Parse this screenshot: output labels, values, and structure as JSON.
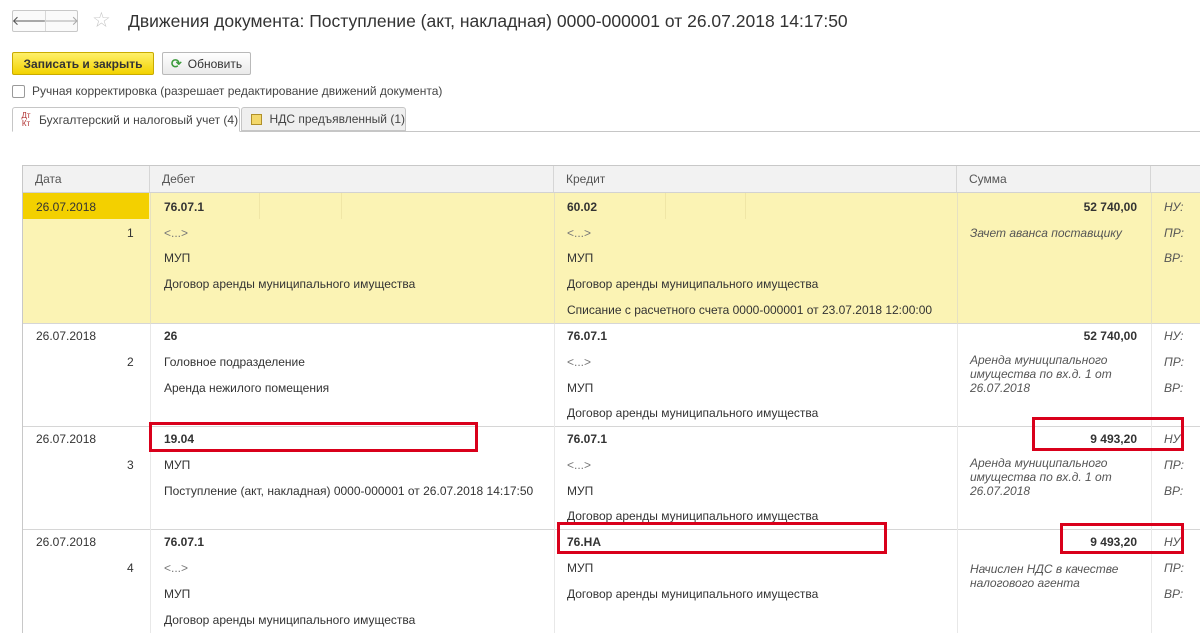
{
  "window": {
    "title": "Движения документа: Поступление (акт, накладная) 0000-000001 от 26.07.2018 14:17:50",
    "back_icon": "arrow-left-icon",
    "forward_icon": "arrow-right-icon",
    "favorite_icon": "star-icon"
  },
  "toolbar": {
    "save_close_label": "Записать и закрыть",
    "refresh_label": "Обновить",
    "refresh_icon": "refresh-icon"
  },
  "manual_correction": {
    "label": "Ручная корректировка (разрешает редактирование движений документа)",
    "checked": false
  },
  "tabs": [
    {
      "label": "Бухгалтерский и налоговый учет (4)",
      "icon": "dt-kt-icon",
      "icon_text": "Дт\nКт",
      "active": true
    },
    {
      "label": "НДС предъявленный (1)",
      "icon": "register-icon",
      "active": false
    }
  ],
  "grid": {
    "columns": [
      "Дата",
      "Дебет",
      "Кредит",
      "Сумма"
    ],
    "records": [
      {
        "date": "26.07.2018",
        "num": "1",
        "debit": [
          "76.07.1",
          "<...>",
          "МУП",
          "Договор аренды муниципального имущества"
        ],
        "credit": [
          "60.02",
          "<...>",
          "МУП",
          "Договор аренды муниципального имущества",
          "Списание с расчетного счета 0000-000001 от 23.07.2018 12:00:00"
        ],
        "sum": "52 740,00",
        "note": "Зачет аванса поставщику",
        "flags": [
          "НУ:",
          "ПР:",
          "ВР:"
        ],
        "selected": true
      },
      {
        "date": "26.07.2018",
        "num": "2",
        "debit": [
          "26",
          "Головное подразделение",
          "Аренда нежилого помещения"
        ],
        "credit": [
          "76.07.1",
          "<...>",
          "МУП",
          "Договор аренды муниципального имущества"
        ],
        "sum": "52 740,00",
        "note": "Аренда муниципального имущества по вх.д. 1 от 26.07.2018",
        "flags": [
          "НУ:",
          "ПР:",
          "ВР:"
        ],
        "selected": false
      },
      {
        "date": "26.07.2018",
        "num": "3",
        "debit": [
          "19.04",
          "МУП",
          "Поступление (акт, накладная) 0000-000001 от 26.07.2018 14:17:50"
        ],
        "credit": [
          "76.07.1",
          "<...>",
          "МУП",
          "Договор аренды муниципального имущества"
        ],
        "sum": "9 493,20",
        "note": "Аренда муниципального имущества по вх.д. 1 от 26.07.2018",
        "flags": [
          "НУ",
          "ПР:",
          "ВР:"
        ],
        "selected": false
      },
      {
        "date": "26.07.2018",
        "num": "4",
        "debit": [
          "76.07.1",
          "<...>",
          "МУП",
          "Договор аренды муниципального имущества"
        ],
        "credit": [
          "76.НА",
          "МУП",
          "Договор аренды муниципального имущества"
        ],
        "sum": "9 493,20",
        "note": "Начислен НДС в качестве налогового агента",
        "flags": [
          "НУ",
          "ПР:",
          "ВР:"
        ],
        "selected": false
      }
    ]
  },
  "colors": {
    "accent_yellow": "#f3d000",
    "selection": "#fbf3b4",
    "highlight_red": "#d9001b"
  }
}
